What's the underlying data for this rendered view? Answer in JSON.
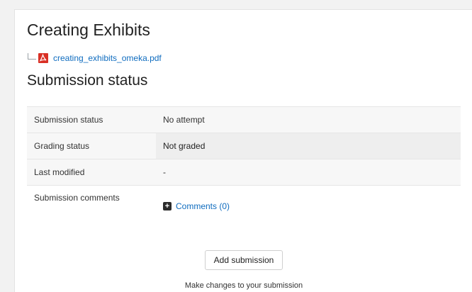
{
  "assignment": {
    "title": "Creating Exhibits",
    "attachment": {
      "filename": "creating_exhibits_omeka.pdf",
      "icon": "pdf-file-icon"
    }
  },
  "submission": {
    "heading": "Submission status",
    "rows": [
      {
        "label": "Submission status",
        "value": "No attempt"
      },
      {
        "label": "Grading status",
        "value": "Not graded"
      },
      {
        "label": "Last modified",
        "value": "-"
      },
      {
        "label": "Submission comments",
        "value": "Comments (0)"
      }
    ],
    "add_button": "Add submission",
    "help_text": "Make changes to your submission"
  },
  "colors": {
    "link": "#0f6cbf",
    "pdf_red": "#d93025",
    "grey_cell": "#eeeeee"
  }
}
